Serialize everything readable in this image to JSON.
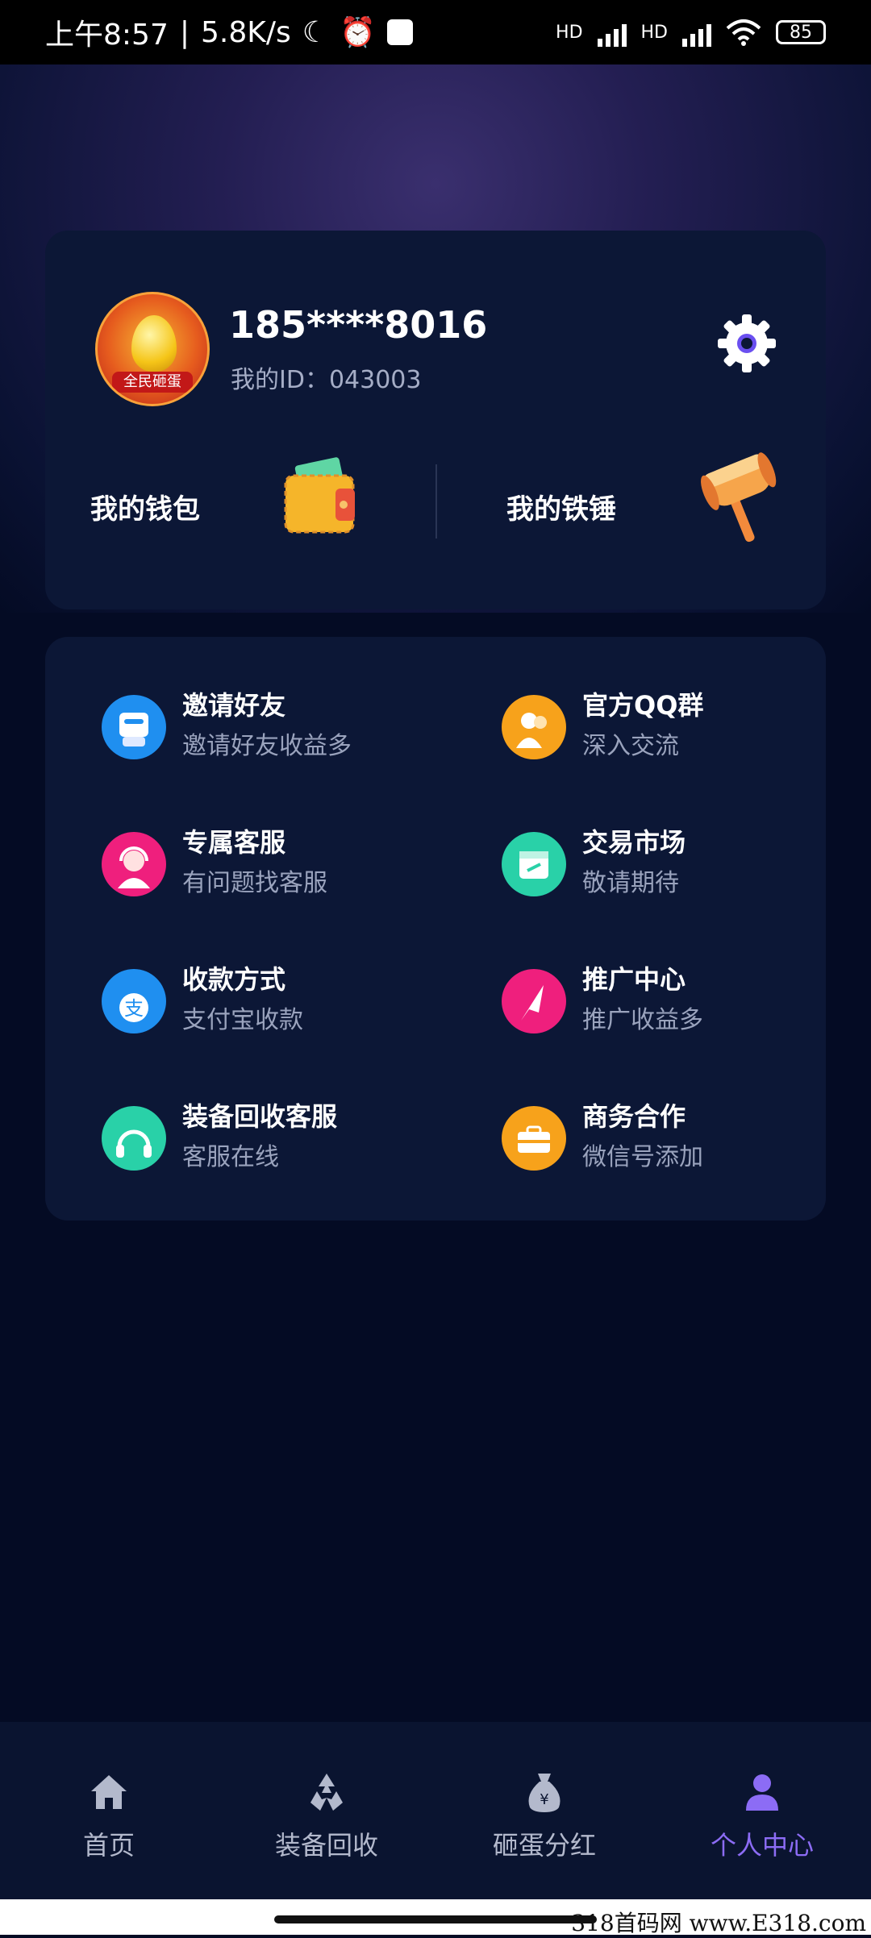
{
  "status_bar": {
    "time": "上午8:57",
    "speed": "5.8K/s",
    "battery": "85",
    "hd1": "HD",
    "hd2": "HD"
  },
  "profile": {
    "avatar_text": "全民砸蛋",
    "phone": "185****8016",
    "id_label": "我的ID：043003",
    "wallet_label": "我的钱包",
    "hammer_label": "我的铁锤"
  },
  "menu": {
    "items": [
      {
        "title": "邀请好友",
        "subtitle": "邀请好友收益多",
        "icon": "invite-icon",
        "color": "#1f8ff0"
      },
      {
        "title": "官方QQ群",
        "subtitle": "深入交流",
        "icon": "qq-group-icon",
        "color": "#f7a21b"
      },
      {
        "title": "专属客服",
        "subtitle": "有问题找客服",
        "icon": "customer-service-icon",
        "color": "#ef1f7d"
      },
      {
        "title": "交易市场",
        "subtitle": "敬请期待",
        "icon": "market-icon",
        "color": "#29d1a8"
      },
      {
        "title": "收款方式",
        "subtitle": "支付宝收款",
        "icon": "alipay-icon",
        "color": "#1f8ff0"
      },
      {
        "title": "推广中心",
        "subtitle": "推广收益多",
        "icon": "promotion-icon",
        "color": "#ef1f7d"
      },
      {
        "title": "装备回收客服",
        "subtitle": "客服在线",
        "icon": "headset-icon",
        "color": "#29d1a8"
      },
      {
        "title": "商务合作",
        "subtitle": "微信号添加",
        "icon": "business-icon",
        "color": "#f7a21b"
      }
    ]
  },
  "nav": {
    "items": [
      {
        "label": "首页",
        "icon": "home-icon"
      },
      {
        "label": "装备回收",
        "icon": "recycle-icon"
      },
      {
        "label": "砸蛋分红",
        "icon": "money-bag-icon"
      },
      {
        "label": "个人中心",
        "icon": "person-icon",
        "active": true
      }
    ]
  },
  "watermark": "318首码网 www.E318.com"
}
